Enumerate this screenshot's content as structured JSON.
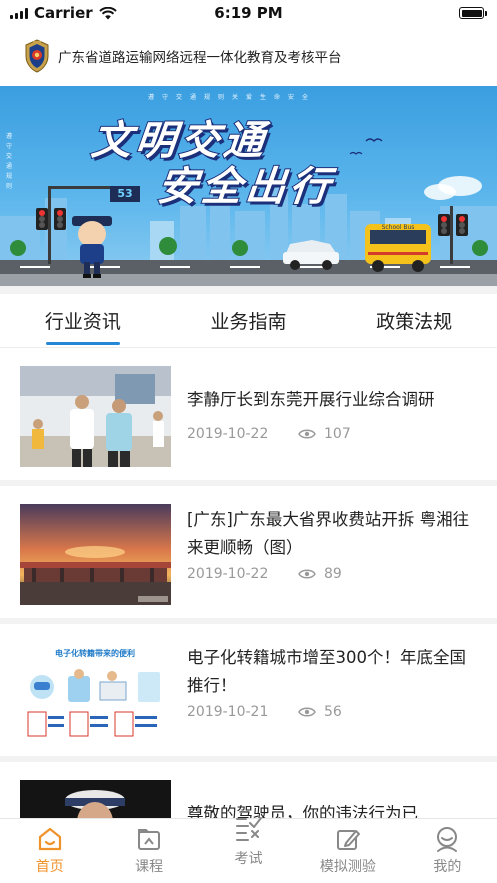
{
  "status_bar": {
    "carrier": "Carrier",
    "time": "6:19 PM",
    "battery_level": 1.0
  },
  "header": {
    "title": "广东省道路运输网络远程一体化教育及考核平台",
    "logo_icon": "police-badge-icon"
  },
  "banner": {
    "line1": "文明交通",
    "line2": "安全出行",
    "small_text": "遵守交通规则关爱生命安全",
    "vertical_text": "遵守交通规则",
    "sign_number": "53",
    "bus_label": "School Bus"
  },
  "tabs": [
    {
      "label": "行业资讯",
      "active": true
    },
    {
      "label": "业务指南",
      "active": false
    },
    {
      "label": "政策法规",
      "active": false
    }
  ],
  "news": [
    {
      "title": "李静厅长到东莞开展行业综合调研",
      "date": "2019-10-22",
      "views": "107"
    },
    {
      "title": "[广东]广东最大省界收费站开拆 粤湘往来更顺畅（图）",
      "date": "2019-10-22",
      "views": "89"
    },
    {
      "title": "电子化转籍城市增至300个！年底全国推行！",
      "date": "2019-10-21",
      "views": "56"
    },
    {
      "title": "尊敬的驾驶员，你的违法行为已",
      "date": "",
      "views": ""
    }
  ],
  "thumb3_heading": "电子化转籍带来的便利",
  "tabbar": [
    {
      "label": "首页",
      "icon": "home-icon",
      "active": true
    },
    {
      "label": "课程",
      "icon": "course-folder-icon",
      "active": false
    },
    {
      "label": "考试",
      "icon": "exam-checklist-icon",
      "active": false
    },
    {
      "label": "模拟测验",
      "icon": "edit-pen-icon",
      "active": false
    },
    {
      "label": "我的",
      "icon": "profile-icon",
      "active": false
    }
  ],
  "colors": {
    "accent": "#2488d6",
    "tab_active": "#f0922a",
    "meta_gray": "#999999"
  }
}
